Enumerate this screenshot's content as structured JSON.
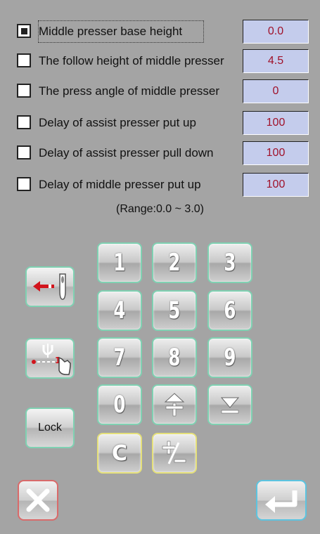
{
  "params": [
    {
      "label": "Middle presser base height",
      "value": "0.0",
      "checked": true
    },
    {
      "label": "The follow height of middle presser",
      "value": "4.5",
      "checked": false
    },
    {
      "label": "The press angle of middle presser",
      "value": "0",
      "checked": false
    },
    {
      "label": "Delay of assist presser put up",
      "value": "100",
      "checked": false
    },
    {
      "label": "Delay of assist presser pull down",
      "value": "100",
      "checked": false
    },
    {
      "label": "Delay of middle presser put up",
      "value": "100",
      "checked": false
    }
  ],
  "range_text": "(Range:0.0 ~ 3.0)",
  "keypad": {
    "k1": "1",
    "k2": "2",
    "k3": "3",
    "k4": "4",
    "k5": "5",
    "k6": "6",
    "k7": "7",
    "k8": "8",
    "k9": "9",
    "k0": "0",
    "clear": "C"
  },
  "side_buttons": {
    "lock_label": "Lock",
    "back_icon": "needle-back-arrow-icon",
    "setting_icon": "needle-hand-icon"
  },
  "footer": {
    "cancel_icon": "close-icon",
    "enter_icon": "enter-icon"
  },
  "colors": {
    "background": "#a4a4a4",
    "value_box": "#c4ccec",
    "value_text": "#a0122a",
    "key_border": "#7fd1b2",
    "key_border_yellow": "#e5e07a",
    "cancel_border": "#d96a6a",
    "enter_border": "#5cc4e0"
  }
}
